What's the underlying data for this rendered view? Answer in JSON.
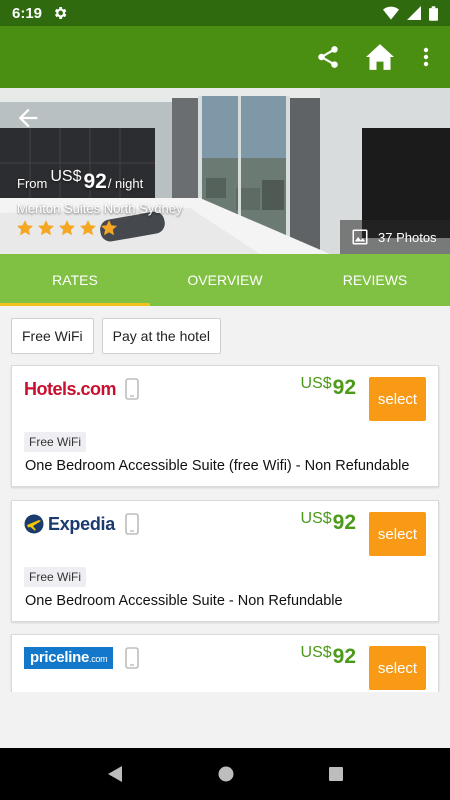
{
  "status": {
    "time": "6:19"
  },
  "hero": {
    "from_label": "From",
    "currency": "US$",
    "price": "92",
    "per_night": "/ night",
    "hotel_name": "Meriton Suites North Sydney",
    "stars": 5,
    "photos_label": "37 Photos"
  },
  "tabs": [
    {
      "label": "RATES",
      "active": true
    },
    {
      "label": "OVERVIEW",
      "active": false
    },
    {
      "label": "REVIEWS",
      "active": false
    }
  ],
  "filters": [
    "Free WiFi",
    "Pay at the hotel"
  ],
  "offers": [
    {
      "provider": "hotels",
      "logo_text": "Hotels.com",
      "currency": "US$",
      "price": "92",
      "select_label": "select",
      "tag": "Free WiFi",
      "room": "One Bedroom Accessible Suite (free Wifi) - Non Refundable"
    },
    {
      "provider": "expedia",
      "logo_text": "Expedia",
      "currency": "US$",
      "price": "92",
      "select_label": "select",
      "tag": "Free WiFi",
      "room": "One Bedroom Accessible Suite - Non Refundable"
    },
    {
      "provider": "priceline",
      "logo_text": "priceline",
      "logo_tld": ".com",
      "currency": "US$",
      "price": "92",
      "select_label": "select"
    }
  ],
  "colors": {
    "status_bar": "#2f6a0e",
    "app_bar": "#4b8f12",
    "tab_bar": "#80c143",
    "tab_indicator": "#f2c21b",
    "price_green": "#4b9a1a",
    "select_orange": "#f99a16",
    "star_orange": "#f5a623"
  },
  "icons": {
    "status": [
      "gear-icon",
      "wifi-icon",
      "signal-icon",
      "battery-icon"
    ],
    "app_bar": [
      "share-icon",
      "home-icon",
      "more-vert-icon"
    ],
    "hero": [
      "back-arrow-icon",
      "photo-icon",
      "star-icon"
    ],
    "nav": [
      "nav-back-icon",
      "nav-home-icon",
      "nav-recents-icon"
    ]
  }
}
